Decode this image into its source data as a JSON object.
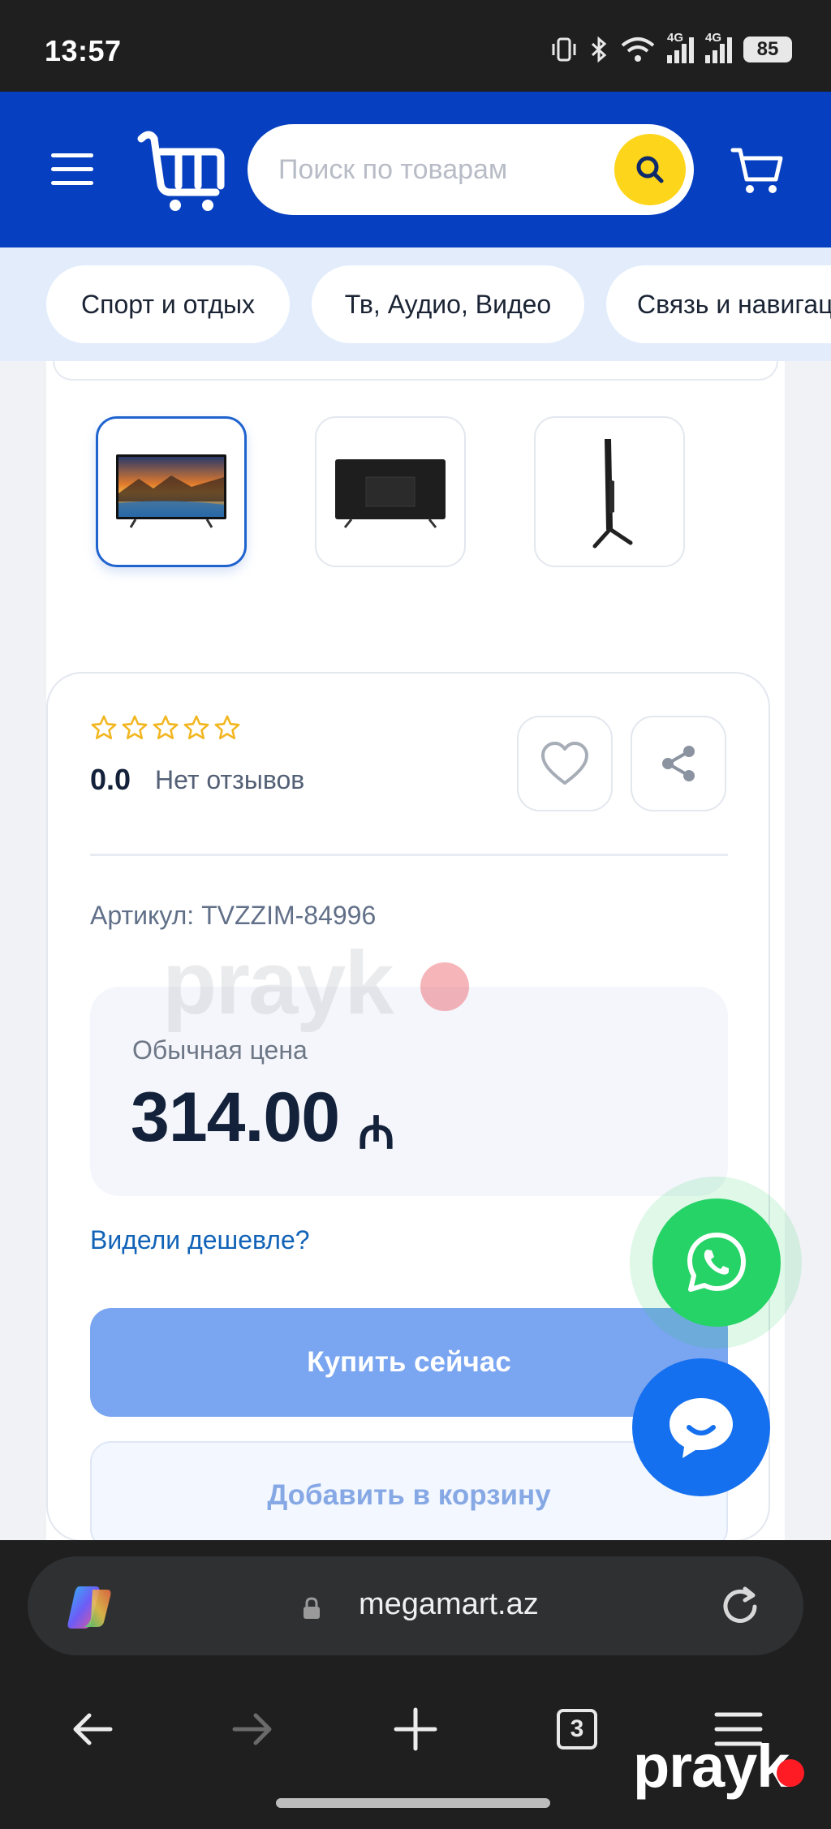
{
  "status_bar": {
    "time": "13:57",
    "battery": "85",
    "network_1": "4G",
    "network_2": "4G"
  },
  "header": {
    "search_placeholder": "Поиск по товарам",
    "brand_color": "#0640c0",
    "search_button_color": "#fdd51b",
    "icons": [
      "menu-icon",
      "megamart-logo",
      "search-icon",
      "cart-icon"
    ]
  },
  "categories": [
    "Спорт и отдых",
    "Тв, Аудио, Видео",
    "Связь и навигац"
  ],
  "gallery": {
    "thumbnails": [
      "tv-front-image",
      "tv-back-image",
      "tv-side-image"
    ],
    "active_index": 0
  },
  "product": {
    "stars_filled": 0,
    "stars_total": 5,
    "rating": "0.0",
    "reviews": "Нет отзывов",
    "sku": "Артикул: TVZZIM-84996",
    "price_label": "Обычная цена",
    "price": "314.00",
    "currency": "₼",
    "cheaper_link": "Видели дешевле?",
    "buy_now": "Купить сейчас",
    "add_to_cart": "Добавить в корзину"
  },
  "floating": {
    "whatsapp_color": "#25d366",
    "chat_color": "#1570ef"
  },
  "browser": {
    "url": "megamart.az",
    "tab_count": "3"
  },
  "watermark": {
    "text": "prayk"
  }
}
